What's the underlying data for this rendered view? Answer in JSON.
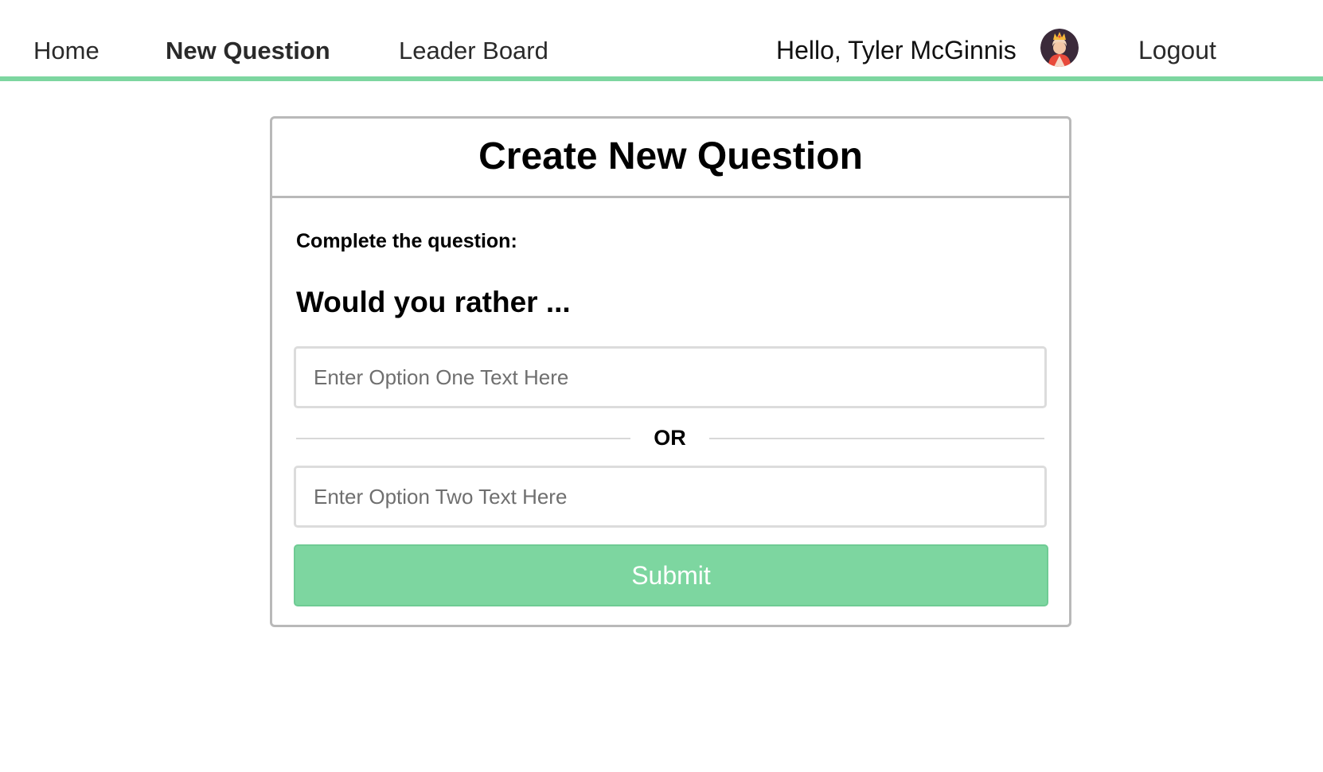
{
  "nav": {
    "home": "Home",
    "new_question": "New Question",
    "leader_board": "Leader Board",
    "greeting": "Hello, Tyler McGinnis",
    "logout": "Logout"
  },
  "accent_color": "#7dd6a0",
  "card": {
    "title": "Create New Question",
    "complete_label": "Complete the question:",
    "would_you_rather": "Would you rather ...",
    "option_one_placeholder": "Enter Option One Text Here",
    "option_one_value": "",
    "or_label": "OR",
    "option_two_placeholder": "Enter Option Two Text Here",
    "option_two_value": "",
    "submit_label": "Submit"
  },
  "avatar": {
    "icon": "queen-avatar-icon"
  }
}
